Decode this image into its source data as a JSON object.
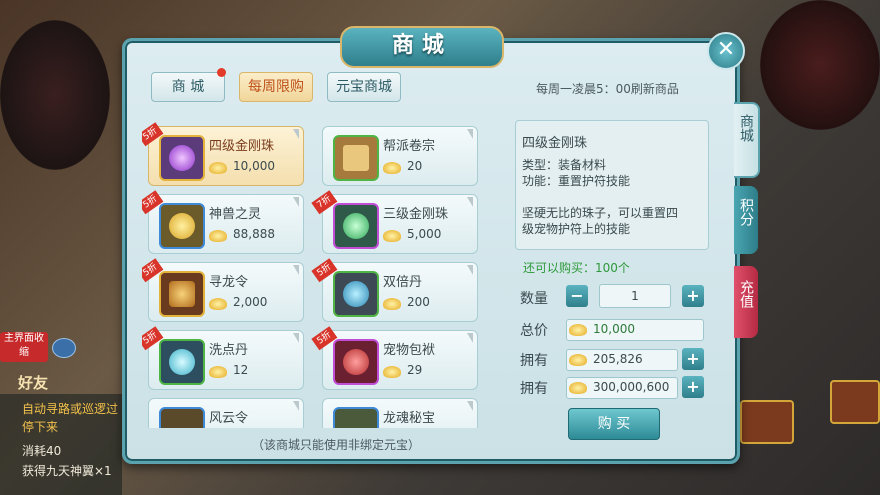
{
  "title": "商城",
  "tabs": [
    {
      "label": "商 城"
    },
    {
      "label": "每周限购"
    },
    {
      "label": "元宝商城"
    }
  ],
  "refresh_text": "每周一凌晨5：00刷新商品",
  "items": [
    {
      "name": "四级金刚珠",
      "price": "10,000",
      "discount": "5折"
    },
    {
      "name": "帮派卷宗",
      "price": "20",
      "discount": ""
    },
    {
      "name": "神兽之灵",
      "price": "88,888",
      "discount": "5折"
    },
    {
      "name": "三级金刚珠",
      "price": "5,000",
      "discount": "7折"
    },
    {
      "name": "寻龙令",
      "price": "2,000",
      "discount": "5折"
    },
    {
      "name": "双倍丹",
      "price": "200",
      "discount": "5折"
    },
    {
      "name": "洗点丹",
      "price": "12",
      "discount": "5折"
    },
    {
      "name": "宠物包袱",
      "price": "29",
      "discount": "5折"
    },
    {
      "name": "风云令",
      "price": "",
      "discount": ""
    },
    {
      "name": "龙魂秘宝",
      "price": "",
      "discount": ""
    }
  ],
  "note": "（该商城只能使用非绑定元宝）",
  "detail": {
    "name": "四级金刚珠",
    "type": "类型：装备材料",
    "func": "功能：重置护符技能",
    "desc1": "坚硬无比的珠子，可以重置四",
    "desc2": "级宠物护符上的技能"
  },
  "can_buy": "还可以购买：100个",
  "qty_label": "数量",
  "qty": "1",
  "total_label": "总价",
  "total": "10,000",
  "own_label1": "拥有",
  "own1": "205,826",
  "own_label2": "拥有",
  "own2": "300,000,600",
  "buy_label": "购 买",
  "side_tabs": [
    {
      "label": "商城"
    },
    {
      "label": "积分"
    },
    {
      "label": "充值"
    }
  ],
  "close_icon": "close-icon",
  "chat": {
    "friend": "好友",
    "collapse": "主界面收缩",
    "line1": "自动寻路或巡逻过",
    "line2": "停下来",
    "line3": "消耗40",
    "line4": "获得九天神翼×1"
  },
  "colors": {
    "accent": "#2f7f8c",
    "active_tab": "#c0521c",
    "discount": "#d8342a"
  }
}
